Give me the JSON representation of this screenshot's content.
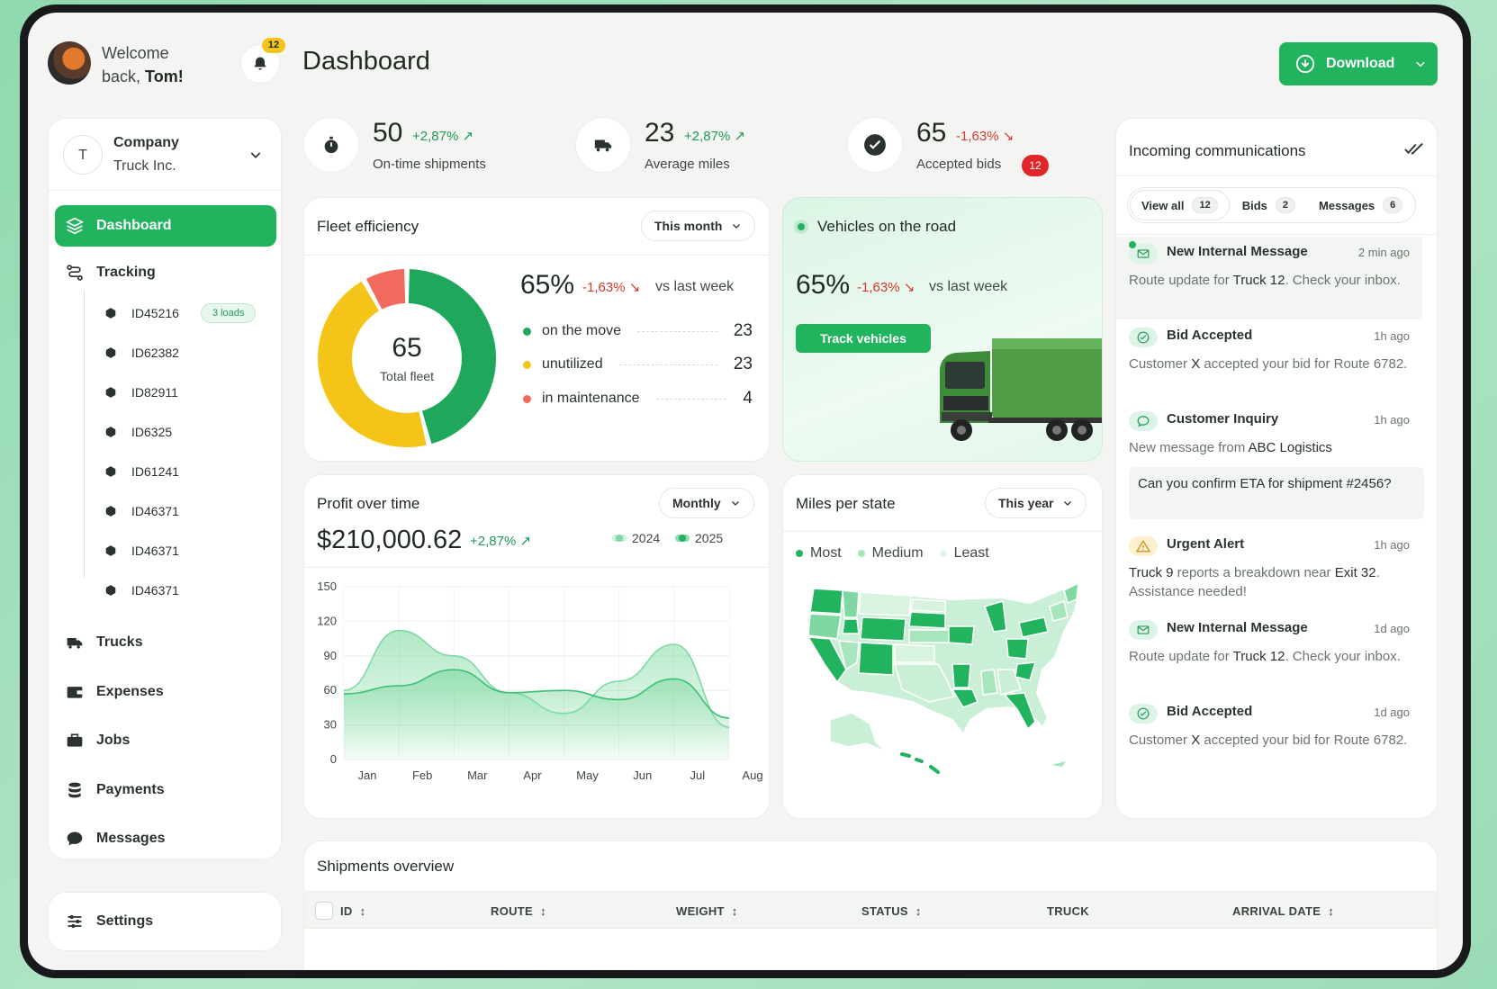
{
  "header": {
    "welcome_line1": "Welcome",
    "welcome_line2": "back,",
    "user_name": "Tom!",
    "notification_count": "12",
    "page_title": "Dashboard",
    "download_label": "Download"
  },
  "company": {
    "avatar_letter": "T",
    "label": "Company",
    "name": "Truck Inc."
  },
  "nav": {
    "dashboard": "Dashboard",
    "tracking": "Tracking",
    "tracking_items": [
      {
        "id": "ID45216",
        "badge": "3 loads"
      },
      {
        "id": "ID62382"
      },
      {
        "id": "ID82911"
      },
      {
        "id": "ID6325"
      },
      {
        "id": "ID61241"
      },
      {
        "id": "ID46371"
      },
      {
        "id": "ID46371"
      },
      {
        "id": "ID46371"
      }
    ],
    "trucks": "Trucks",
    "expenses": "Expenses",
    "jobs": "Jobs",
    "payments": "Payments",
    "messages": "Messages",
    "settings": "Settings"
  },
  "kpis": [
    {
      "value": "50",
      "delta": "+2,87%",
      "label": "On-time shipments",
      "trend": "up"
    },
    {
      "value": "23",
      "delta": "+2,87%",
      "label": "Average miles",
      "trend": "up"
    },
    {
      "value": "65",
      "delta": "-1,63%",
      "label": "Accepted bids",
      "badge": "12",
      "trend": "down"
    }
  ],
  "fleet": {
    "title": "Fleet efficiency",
    "period": "This month",
    "center_value": "65",
    "center_label": "Total fleet",
    "percent": "65%",
    "delta": "-1,63%",
    "compare": "vs last week",
    "legend": [
      {
        "label": "on the move",
        "value": 23,
        "color": "#1fa85b"
      },
      {
        "label": "unutilized",
        "value": 23,
        "color": "#f5c418"
      },
      {
        "label": "in maintenance",
        "value": 4,
        "color": "#f26a5e"
      }
    ]
  },
  "vehicles": {
    "title": "Vehicles on the road",
    "percent": "65%",
    "delta": "-1,63%",
    "compare": "vs last week",
    "button": "Track vehicles"
  },
  "profit": {
    "title": "Profit over time",
    "period": "Monthly",
    "total": "$210,000.62",
    "delta": "+2,87%"
  },
  "chart_data": {
    "type": "area",
    "title": "Profit over time",
    "categories": [
      "Jan",
      "Feb",
      "Mar",
      "Apr",
      "May",
      "Jun",
      "Jul",
      "Aug"
    ],
    "ylim": [
      0,
      150
    ],
    "yticks": [
      0,
      30,
      60,
      90,
      120,
      150
    ],
    "series": [
      {
        "name": "2024",
        "values": [
          60,
          112,
          90,
          58,
          40,
          68,
          100,
          28
        ],
        "color": "#7ed9a3"
      },
      {
        "name": "2025",
        "values": [
          57,
          64,
          78,
          58,
          60,
          52,
          70,
          36
        ],
        "color": "#3fbf75"
      }
    ]
  },
  "miles": {
    "title": "Miles per state",
    "period": "This year",
    "legend": [
      {
        "label": "Most",
        "color": "#22b35f"
      },
      {
        "label": "Medium",
        "color": "#a7e6bd"
      },
      {
        "label": "Least",
        "color": "#e2f6e8"
      }
    ]
  },
  "communications": {
    "title": "Incoming communications",
    "tabs": [
      {
        "label": "View all",
        "count": "12"
      },
      {
        "label": "Bids",
        "count": "2"
      },
      {
        "label": "Messages",
        "count": "6"
      }
    ],
    "items": [
      {
        "title": "New Internal Message",
        "time": "2 min ago",
        "pre": "Route update for ",
        "bold": "Truck 12",
        "post": ". Check your inbox.",
        "icon": "mail-icon"
      },
      {
        "title": "Bid Accepted",
        "time": "1h ago",
        "pre": "Customer ",
        "bold": "X",
        "post": " accepted your bid for Route 6782.",
        "icon": "check-circle-icon"
      },
      {
        "title": "Customer Inquiry",
        "time": "1h ago",
        "pre": "New message from ",
        "bold": "ABC Logistics",
        "post": "",
        "quote": "Can you confirm ETA for shipment #2456?",
        "icon": "chat-icon"
      },
      {
        "title": "Urgent Alert",
        "time": "1h ago",
        "pre": "",
        "bold": "Truck 9",
        "post": " reports a breakdown near ",
        "bold2": "Exit 32",
        "post2": ". Assistance needed!",
        "icon": "warning-icon"
      },
      {
        "title": "New Internal Message",
        "time": "1d ago",
        "pre": "Route update for ",
        "bold": "Truck 12",
        "post": ". Check your inbox.",
        "icon": "mail-icon"
      },
      {
        "title": "Bid Accepted",
        "time": "1d ago",
        "pre": "Customer ",
        "bold": "X",
        "post": " accepted your bid for Route 6782.",
        "icon": "check-circle-icon"
      }
    ]
  },
  "shipments": {
    "title": "Shipments overview",
    "columns": [
      "ID",
      "ROUTE",
      "WEIGHT",
      "STATUS",
      "TRUCK",
      "ARRIVAL DATE"
    ]
  },
  "colors": {
    "accent": "#22b35f",
    "positive": "#1f9a54",
    "negative": "#d23a2d"
  }
}
